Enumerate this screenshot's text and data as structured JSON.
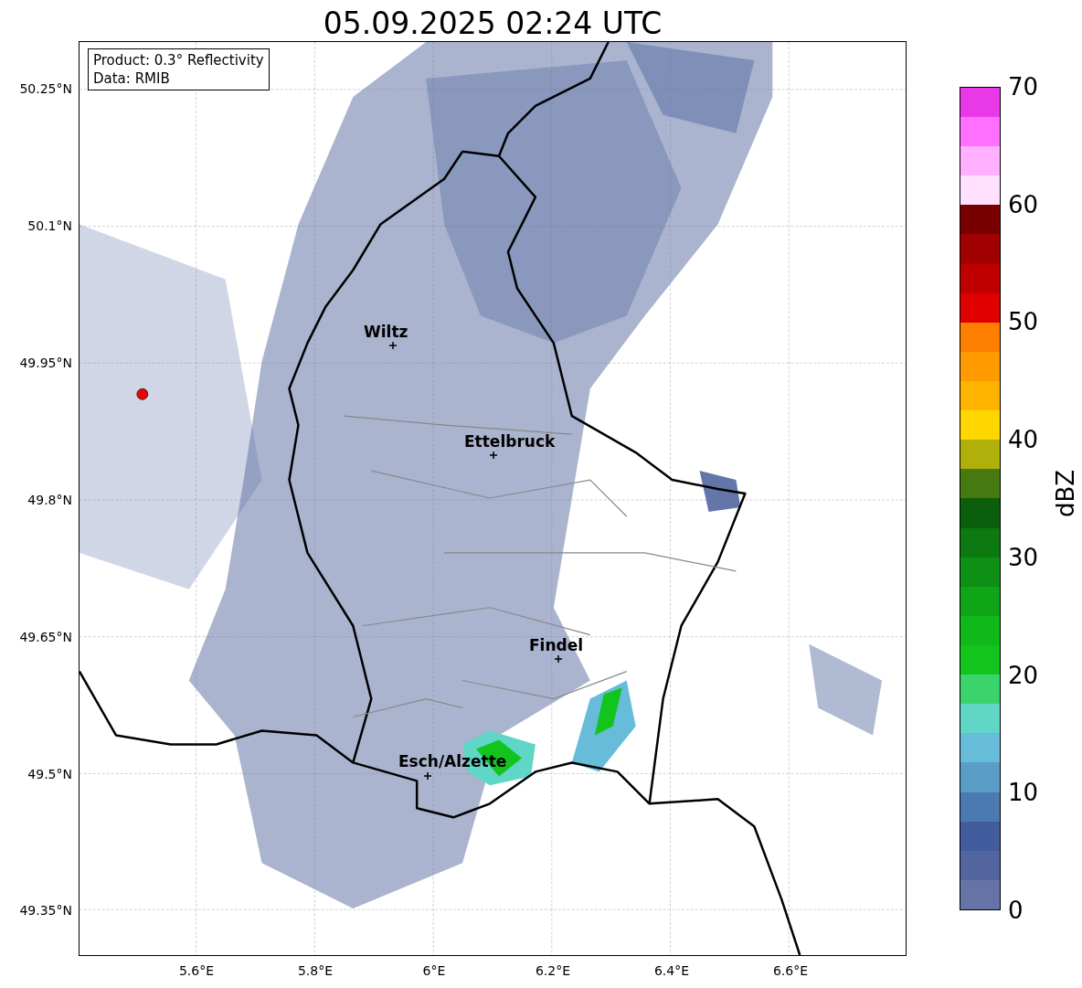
{
  "title": "05.09.2025 02:24 UTC",
  "info_box": {
    "lines": [
      "Product: 0.3° Reflectivity",
      "Data: RMIB"
    ]
  },
  "y_ticks": [
    "50.25°N",
    "50.1°N",
    "49.95°N",
    "49.8°N",
    "49.65°N",
    "49.5°N",
    "49.35°N"
  ],
  "x_ticks": [
    "5.6°E",
    "5.8°E",
    "6°E",
    "6.2°E",
    "6.4°E",
    "6.6°E"
  ],
  "cities": [
    {
      "name": "Wiltz"
    },
    {
      "name": "Ettelbruck"
    },
    {
      "name": "Findel"
    },
    {
      "name": "Esch/Alzette"
    }
  ],
  "colorbar": {
    "label": "dBZ",
    "ticks": [
      "70",
      "60",
      "50",
      "40",
      "30",
      "20",
      "10",
      "0"
    ],
    "bins": [
      {
        "color": "#6673a6"
      },
      {
        "color": "#52659e"
      },
      {
        "color": "#435c9e"
      },
      {
        "color": "#4a7ab0"
      },
      {
        "color": "#5a9ec8"
      },
      {
        "color": "#66bcd9"
      },
      {
        "color": "#5fd6c6"
      },
      {
        "color": "#3bd46c"
      },
      {
        "color": "#12c41c"
      },
      {
        "color": "#10b81a"
      },
      {
        "color": "#0fa516"
      },
      {
        "color": "#0e9014"
      },
      {
        "color": "#0c7a10"
      },
      {
        "color": "#0a5e0c"
      },
      {
        "color": "#467a10"
      },
      {
        "color": "#b0b00a"
      },
      {
        "color": "#ffd700"
      },
      {
        "color": "#ffb400"
      },
      {
        "color": "#ff9a00"
      },
      {
        "color": "#ff7f00"
      },
      {
        "color": "#e00000"
      },
      {
        "color": "#c00000"
      },
      {
        "color": "#a00000"
      },
      {
        "color": "#780000"
      },
      {
        "color": "#ffe0ff"
      },
      {
        "color": "#ffb0ff"
      },
      {
        "color": "#ff70ff"
      },
      {
        "color": "#e838e8"
      }
    ]
  }
}
